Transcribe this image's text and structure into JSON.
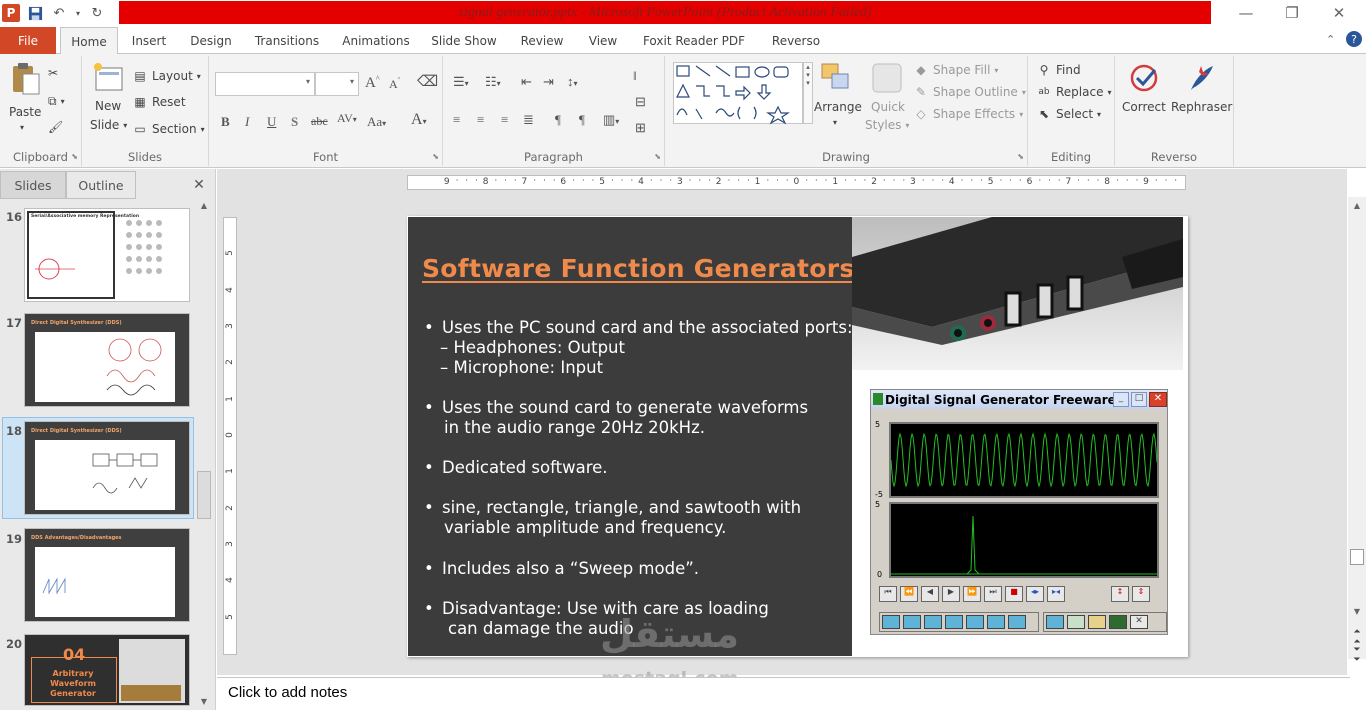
{
  "window": {
    "title": "signal generator.pptx  -  Microsoft PowerPoint (Product Activation Failed)",
    "minimize": "—",
    "restore": "❐",
    "close": "✕"
  },
  "tabs": {
    "file": "File",
    "items": [
      "Home",
      "Insert",
      "Design",
      "Transitions",
      "Animations",
      "Slide Show",
      "Review",
      "View",
      "Foxit Reader PDF",
      "Reverso"
    ]
  },
  "ribbon": {
    "clipboard": {
      "label": "Clipboard",
      "paste": "Paste"
    },
    "slides": {
      "label": "Slides",
      "new": "New",
      "slide": "Slide",
      "layout": "Layout",
      "reset": "Reset",
      "section": "Section"
    },
    "font": {
      "label": "Font"
    },
    "paragraph": {
      "label": "Paragraph"
    },
    "drawing": {
      "label": "Drawing",
      "arrange": "Arrange",
      "quick": "Quick",
      "styles": "Styles",
      "shape_fill": "Shape Fill",
      "shape_outline": "Shape Outline",
      "shape_effects": "Shape Effects"
    },
    "editing": {
      "label": "Editing",
      "find": "Find",
      "replace": "Replace",
      "select": "Select"
    },
    "reverso": {
      "label": "Reverso",
      "correct": "Correct",
      "rephraser": "Rephraser"
    }
  },
  "left_pane": {
    "tabs": [
      "Slides",
      "Outline"
    ],
    "close": "✕",
    "slides": [
      {
        "num": "16",
        "title": "Serial/Associative memory Representation"
      },
      {
        "num": "17",
        "title": "Direct Digital Synthesizer (DDS)"
      },
      {
        "num": "18",
        "title": "Direct Digital Synthesizer (DDS)"
      },
      {
        "num": "19",
        "title": "DDS Advantages/Disadvantages"
      },
      {
        "num": "20",
        "title": "04",
        "subtitle": "Arbitrary Waveform Generator"
      }
    ]
  },
  "ruler": {
    "h_labels": [
      "9",
      "8",
      "7",
      "6",
      "5",
      "4",
      "3",
      "2",
      "1",
      "0",
      "1",
      "2",
      "3",
      "4",
      "5",
      "6",
      "7",
      "8",
      "9"
    ],
    "v_labels": [
      "5",
      "4",
      "3",
      "2",
      "1",
      "0",
      "1",
      "2",
      "3",
      "4",
      "5"
    ]
  },
  "slide": {
    "title": "Software Function Generators",
    "bullets": [
      {
        "lines": [
          "Uses the PC sound card and the associated ports:",
          "– Headphones: Output",
          "– Microphone: Input"
        ]
      },
      {
        "lines": [
          "Uses the sound card to generate waveforms",
          "in the audio range 20Hz 20kHz."
        ]
      },
      {
        "lines": [
          "Dedicated software."
        ]
      },
      {
        "lines": [
          "sine, rectangle, triangle, and sawtooth with",
          "variable amplitude and frequency."
        ]
      },
      {
        "lines": [
          "Includes also a “Sweep mode”."
        ]
      },
      {
        "lines": [
          "Disadvantage: Use with care as loading",
          "can damage the audio"
        ]
      }
    ],
    "app_window_title": "Digital Signal Generator  Freeware...",
    "scope_top_ticks": [
      "5",
      "-5"
    ],
    "scope_bottom_ticks": [
      "5",
      "0"
    ]
  },
  "notes": {
    "placeholder": "Click to add notes"
  },
  "watermark": {
    "arabic": "مستقل",
    "latin": "mostaql.com"
  },
  "colors": {
    "accent_file": "#d24726",
    "title_bar_red": "#e50000",
    "slide_bg": "#3c3c3c",
    "slide_title": "#f08a4b",
    "scope_wave": "#22c022"
  }
}
